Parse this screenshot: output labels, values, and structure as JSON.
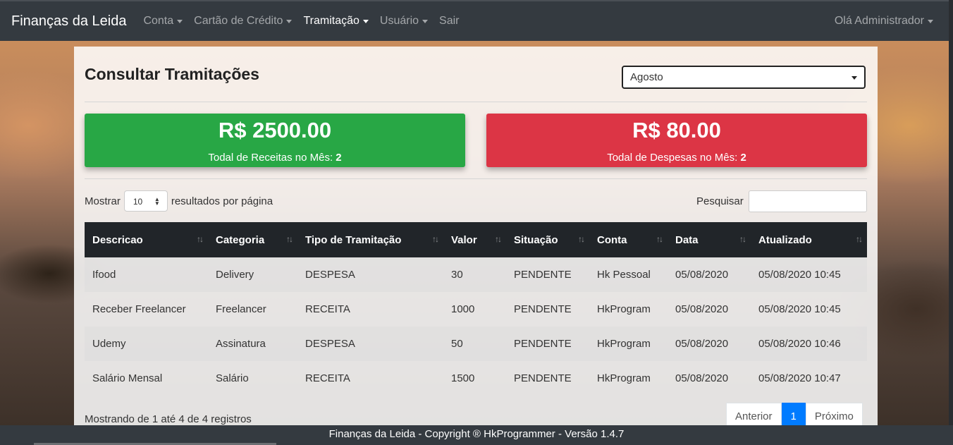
{
  "navbar": {
    "brand": "Finanças da Leida",
    "items": [
      {
        "label": "Conta"
      },
      {
        "label": "Cartão de Crédito"
      },
      {
        "label": "Tramitação"
      },
      {
        "label": "Usuário"
      },
      {
        "label": "Sair"
      }
    ],
    "user": "Olá Administrador"
  },
  "page": {
    "title": "Consultar Tramitações",
    "month_selected": "Agosto"
  },
  "stats": {
    "income_amount": "R$ 2500.00",
    "income_label": "Todal de Receitas no Mês:",
    "income_count": "2",
    "expense_amount": "R$ 80.00",
    "expense_label": "Todal de Despesas no Mês:",
    "expense_count": "2"
  },
  "controls": {
    "show_label": "Mostrar",
    "page_size": "10",
    "per_page_label": "resultados por página",
    "search_label": "Pesquisar"
  },
  "table": {
    "headers": [
      "Descricao",
      "Categoria",
      "Tipo de Tramitação",
      "Valor",
      "Situação",
      "Conta",
      "Data",
      "Atualizado"
    ],
    "rows": [
      [
        "Ifood",
        "Delivery",
        "DESPESA",
        "30",
        "PENDENTE",
        "Hk Pessoal",
        "05/08/2020",
        "05/08/2020 10:45"
      ],
      [
        "Receber Freelancer",
        "Freelancer",
        "RECEITA",
        "1000",
        "PENDENTE",
        "HkProgram",
        "05/08/2020",
        "05/08/2020 10:45"
      ],
      [
        "Udemy",
        "Assinatura",
        "DESPESA",
        "50",
        "PENDENTE",
        "HkProgram",
        "05/08/2020",
        "05/08/2020 10:46"
      ],
      [
        "Salário Mensal",
        "Salário",
        "RECEITA",
        "1500",
        "PENDENTE",
        "HkProgram",
        "05/08/2020",
        "05/08/2020 10:47"
      ]
    ]
  },
  "pagination": {
    "info": "Mostrando de 1 até 4 de 4 registros",
    "prev": "Anterior",
    "current": "1",
    "next": "Próximo"
  },
  "footer": {
    "text": "Finanças da Leida - Copyright ® HkProgrammer - Versão 1.4.7"
  },
  "colors": {
    "navbar": "#343a40",
    "income": "#28a745",
    "expense": "#dc3545",
    "accent": "#007bff"
  }
}
